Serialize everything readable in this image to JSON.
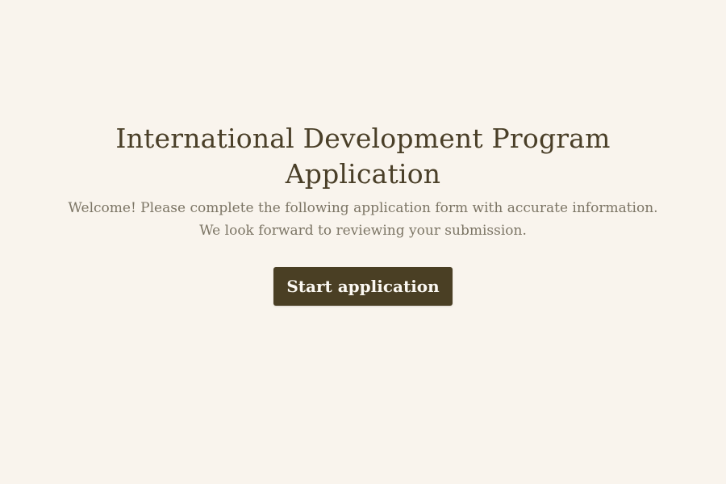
{
  "welcome": {
    "title": "International Development Program Application",
    "description_line1": "Welcome! Please complete the following application form with accurate information.",
    "description_line2": "We look forward to reviewing your submission.",
    "start_button_label": "Start application"
  },
  "colors": {
    "background": "#f9f4ed",
    "title": "#4a3f28",
    "description": "#7c7565",
    "button_bg": "#4a3f24",
    "button_text": "#fbf8f2"
  }
}
